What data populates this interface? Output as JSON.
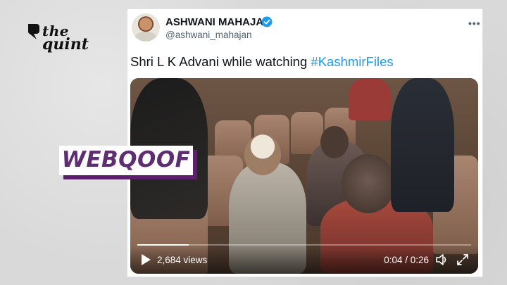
{
  "brand": {
    "line1": "the",
    "line2": "quint"
  },
  "tweet": {
    "author_name": "ASHWANI MAHAJAN",
    "handle": "@ashwani_mahajan",
    "verified": true,
    "text_prefix": "Shri L K Advani while watching ",
    "hashtag": "#KashmirFiles",
    "more_icon": "more-horizontal-icon"
  },
  "video": {
    "views": "2,684 views",
    "time": "0:04 / 0:26",
    "progress": 0.154,
    "icons": [
      "play-icon",
      "volume-icon",
      "fullscreen-icon"
    ]
  },
  "badge": {
    "label": "WEBQOOF"
  },
  "colors": {
    "hashtag": "#1d9bf0",
    "verified": "#1d9bf0",
    "badge_text": "#5e2d72",
    "badge_shadow": "#5b1f6e"
  }
}
